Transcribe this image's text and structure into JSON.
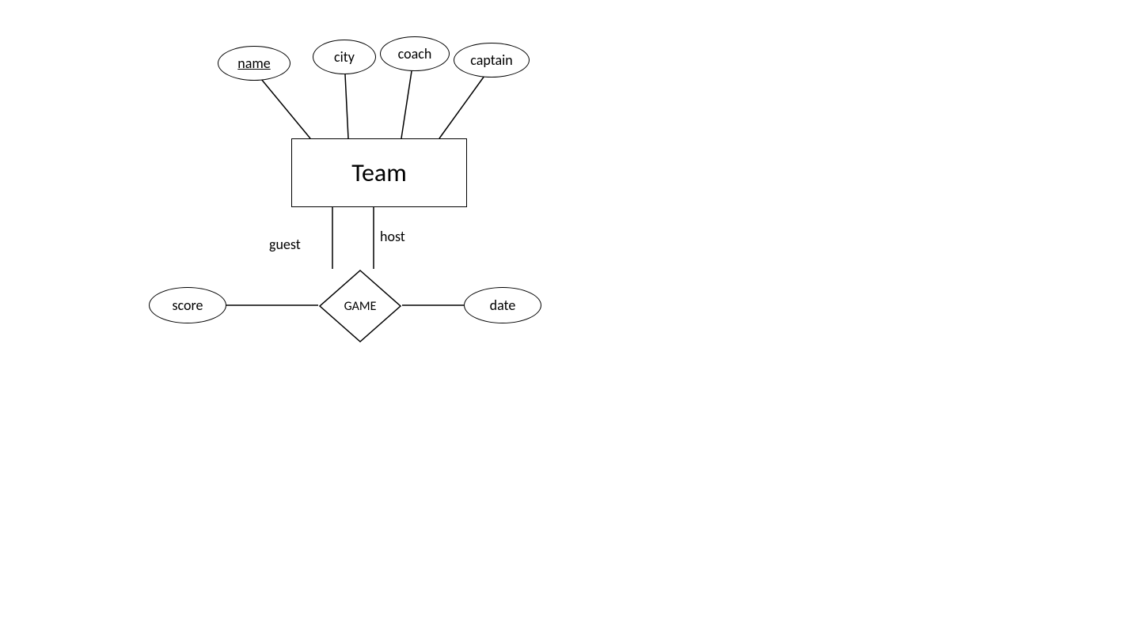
{
  "entity": {
    "team_label": "Team"
  },
  "attributes": {
    "name": "name",
    "city": "city",
    "coach": "coach",
    "captain": "captain",
    "score": "score",
    "date": "date"
  },
  "relationship": {
    "game_label": "GAME"
  },
  "roles": {
    "guest": "guest",
    "host": "host"
  }
}
